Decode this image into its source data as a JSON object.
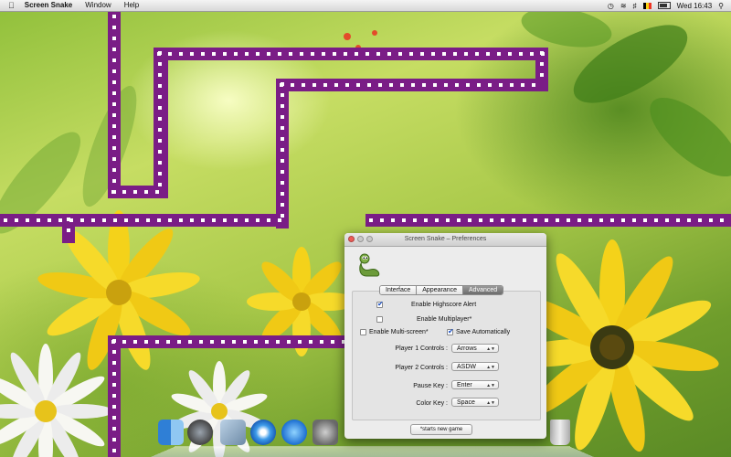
{
  "menubar": {
    "app_name": "Screen Snake",
    "menus": [
      "Window",
      "Help"
    ],
    "clock": "Wed 16:43"
  },
  "preferences": {
    "title": "Screen Snake – Preferences",
    "tabs": [
      {
        "label": "Interface",
        "active": false
      },
      {
        "label": "Appearance",
        "active": false
      },
      {
        "label": "Advanced",
        "active": true
      }
    ],
    "checkboxes": {
      "highscore_alert": {
        "label": "Enable Highscore Alert",
        "checked": true
      },
      "multiplayer": {
        "label": "Enable Multiplayer*",
        "checked": false
      },
      "multi_screen": {
        "label": "Enable Multi-screen*",
        "checked": false
      },
      "save_auto": {
        "label": "Save Automatically",
        "checked": true
      }
    },
    "controls": [
      {
        "label": "Player 1 Controls :",
        "value": "Arrows"
      },
      {
        "label": "Player 2 Controls :",
        "value": "ASDW"
      },
      {
        "label": "Pause Key :",
        "value": "Enter"
      },
      {
        "label": "Color Key :",
        "value": "Space"
      }
    ],
    "footer_button": "*starts new game"
  },
  "colors": {
    "snake": "#7a1d86",
    "snake_dots": "#ffffff",
    "accent": "#1a4fc4"
  },
  "dock": {
    "icons": [
      "finder-icon",
      "launchpad-icon",
      "mail-icon",
      "safari-icon",
      "itunes-icon",
      "system-preferences-icon",
      "trash-icon"
    ]
  }
}
